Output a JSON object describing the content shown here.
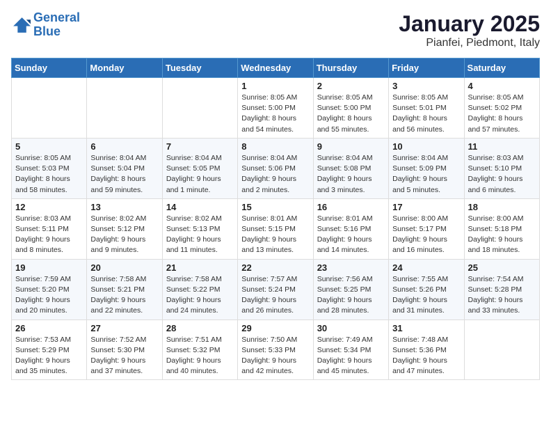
{
  "logo": {
    "line1": "General",
    "line2": "Blue"
  },
  "title": "January 2025",
  "subtitle": "Pianfei, Piedmont, Italy",
  "days_header": [
    "Sunday",
    "Monday",
    "Tuesday",
    "Wednesday",
    "Thursday",
    "Friday",
    "Saturday"
  ],
  "weeks": [
    [
      {
        "day": "",
        "content": ""
      },
      {
        "day": "",
        "content": ""
      },
      {
        "day": "",
        "content": ""
      },
      {
        "day": "1",
        "content": "Sunrise: 8:05 AM\nSunset: 5:00 PM\nDaylight: 8 hours\nand 54 minutes."
      },
      {
        "day": "2",
        "content": "Sunrise: 8:05 AM\nSunset: 5:00 PM\nDaylight: 8 hours\nand 55 minutes."
      },
      {
        "day": "3",
        "content": "Sunrise: 8:05 AM\nSunset: 5:01 PM\nDaylight: 8 hours\nand 56 minutes."
      },
      {
        "day": "4",
        "content": "Sunrise: 8:05 AM\nSunset: 5:02 PM\nDaylight: 8 hours\nand 57 minutes."
      }
    ],
    [
      {
        "day": "5",
        "content": "Sunrise: 8:05 AM\nSunset: 5:03 PM\nDaylight: 8 hours\nand 58 minutes."
      },
      {
        "day": "6",
        "content": "Sunrise: 8:04 AM\nSunset: 5:04 PM\nDaylight: 8 hours\nand 59 minutes."
      },
      {
        "day": "7",
        "content": "Sunrise: 8:04 AM\nSunset: 5:05 PM\nDaylight: 9 hours\nand 1 minute."
      },
      {
        "day": "8",
        "content": "Sunrise: 8:04 AM\nSunset: 5:06 PM\nDaylight: 9 hours\nand 2 minutes."
      },
      {
        "day": "9",
        "content": "Sunrise: 8:04 AM\nSunset: 5:08 PM\nDaylight: 9 hours\nand 3 minutes."
      },
      {
        "day": "10",
        "content": "Sunrise: 8:04 AM\nSunset: 5:09 PM\nDaylight: 9 hours\nand 5 minutes."
      },
      {
        "day": "11",
        "content": "Sunrise: 8:03 AM\nSunset: 5:10 PM\nDaylight: 9 hours\nand 6 minutes."
      }
    ],
    [
      {
        "day": "12",
        "content": "Sunrise: 8:03 AM\nSunset: 5:11 PM\nDaylight: 9 hours\nand 8 minutes."
      },
      {
        "day": "13",
        "content": "Sunrise: 8:02 AM\nSunset: 5:12 PM\nDaylight: 9 hours\nand 9 minutes."
      },
      {
        "day": "14",
        "content": "Sunrise: 8:02 AM\nSunset: 5:13 PM\nDaylight: 9 hours\nand 11 minutes."
      },
      {
        "day": "15",
        "content": "Sunrise: 8:01 AM\nSunset: 5:15 PM\nDaylight: 9 hours\nand 13 minutes."
      },
      {
        "day": "16",
        "content": "Sunrise: 8:01 AM\nSunset: 5:16 PM\nDaylight: 9 hours\nand 14 minutes."
      },
      {
        "day": "17",
        "content": "Sunrise: 8:00 AM\nSunset: 5:17 PM\nDaylight: 9 hours\nand 16 minutes."
      },
      {
        "day": "18",
        "content": "Sunrise: 8:00 AM\nSunset: 5:18 PM\nDaylight: 9 hours\nand 18 minutes."
      }
    ],
    [
      {
        "day": "19",
        "content": "Sunrise: 7:59 AM\nSunset: 5:20 PM\nDaylight: 9 hours\nand 20 minutes."
      },
      {
        "day": "20",
        "content": "Sunrise: 7:58 AM\nSunset: 5:21 PM\nDaylight: 9 hours\nand 22 minutes."
      },
      {
        "day": "21",
        "content": "Sunrise: 7:58 AM\nSunset: 5:22 PM\nDaylight: 9 hours\nand 24 minutes."
      },
      {
        "day": "22",
        "content": "Sunrise: 7:57 AM\nSunset: 5:24 PM\nDaylight: 9 hours\nand 26 minutes."
      },
      {
        "day": "23",
        "content": "Sunrise: 7:56 AM\nSunset: 5:25 PM\nDaylight: 9 hours\nand 28 minutes."
      },
      {
        "day": "24",
        "content": "Sunrise: 7:55 AM\nSunset: 5:26 PM\nDaylight: 9 hours\nand 31 minutes."
      },
      {
        "day": "25",
        "content": "Sunrise: 7:54 AM\nSunset: 5:28 PM\nDaylight: 9 hours\nand 33 minutes."
      }
    ],
    [
      {
        "day": "26",
        "content": "Sunrise: 7:53 AM\nSunset: 5:29 PM\nDaylight: 9 hours\nand 35 minutes."
      },
      {
        "day": "27",
        "content": "Sunrise: 7:52 AM\nSunset: 5:30 PM\nDaylight: 9 hours\nand 37 minutes."
      },
      {
        "day": "28",
        "content": "Sunrise: 7:51 AM\nSunset: 5:32 PM\nDaylight: 9 hours\nand 40 minutes."
      },
      {
        "day": "29",
        "content": "Sunrise: 7:50 AM\nSunset: 5:33 PM\nDaylight: 9 hours\nand 42 minutes."
      },
      {
        "day": "30",
        "content": "Sunrise: 7:49 AM\nSunset: 5:34 PM\nDaylight: 9 hours\nand 45 minutes."
      },
      {
        "day": "31",
        "content": "Sunrise: 7:48 AM\nSunset: 5:36 PM\nDaylight: 9 hours\nand 47 minutes."
      },
      {
        "day": "",
        "content": ""
      }
    ]
  ]
}
